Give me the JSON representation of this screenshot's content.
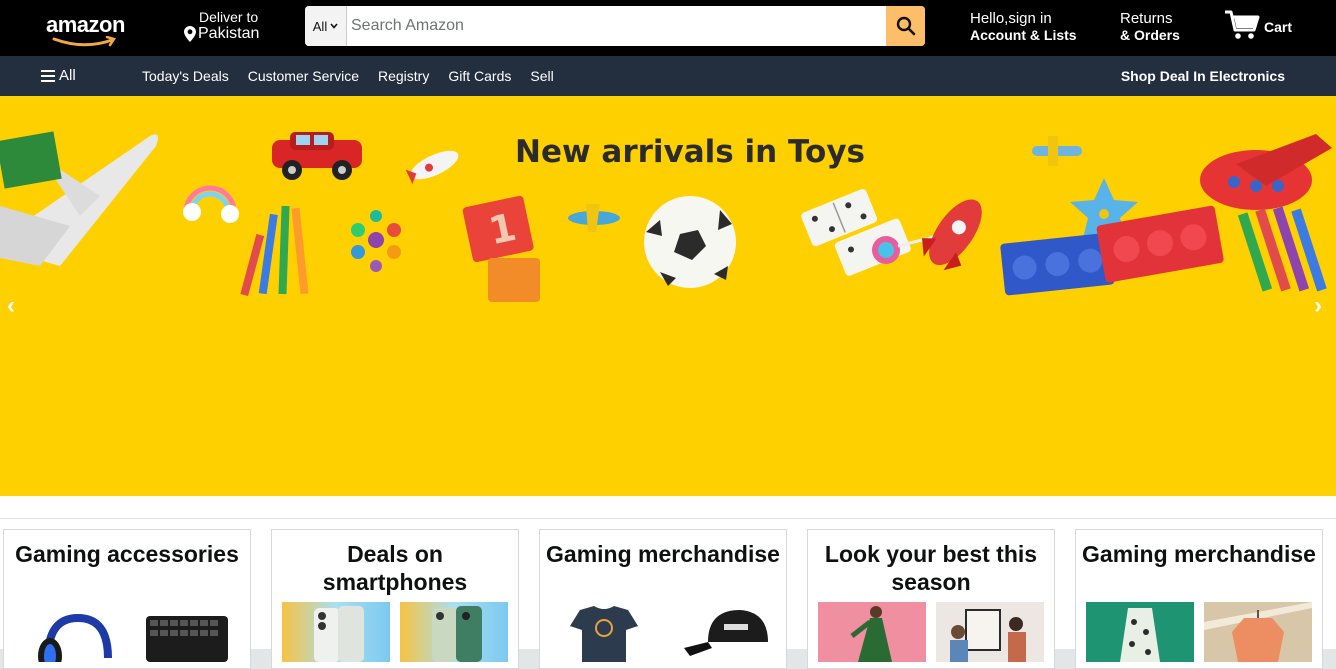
{
  "header": {
    "logo_text": "amazon",
    "deliver_line1": "Deliver to",
    "deliver_line2": "Pakistan",
    "search_category": "All",
    "search_placeholder": "Search Amazon",
    "account_line1": "Hello,sign in",
    "account_line2": "Account & Lists",
    "returns_line1": "Returns",
    "returns_line2": "& Orders",
    "cart_label": "Cart"
  },
  "subnav": {
    "all_label": "All",
    "links": [
      "Today's Deals",
      "Customer Service",
      "Registry",
      "Gift Cards",
      "Sell"
    ],
    "promo": "Shop Deal In Electronics"
  },
  "hero": {
    "title": "New arrivals in Toys",
    "left_arrow": "‹",
    "right_arrow": "›"
  },
  "cards": [
    {
      "title": "Gaming accessories",
      "images": [
        "gaming-headset",
        "gaming-keyboard"
      ]
    },
    {
      "title": "Deals on smartphones",
      "images": [
        "smartphone-white",
        "smartphone-green"
      ]
    },
    {
      "title": "Gaming merchandise",
      "images": [
        "graphic-tshirt",
        "baseball-cap"
      ]
    },
    {
      "title": "Look your best this season",
      "images": [
        "fashion-woman",
        "couple-art"
      ]
    },
    {
      "title": "Gaming merchandise",
      "images": [
        "patterned-dress",
        "orange-jacket"
      ]
    }
  ],
  "colors": {
    "topnav": "#000000",
    "subnav": "#232f3e",
    "hero": "#fed000",
    "search_button": "#febd69",
    "logo_smile": "#f3a847"
  }
}
